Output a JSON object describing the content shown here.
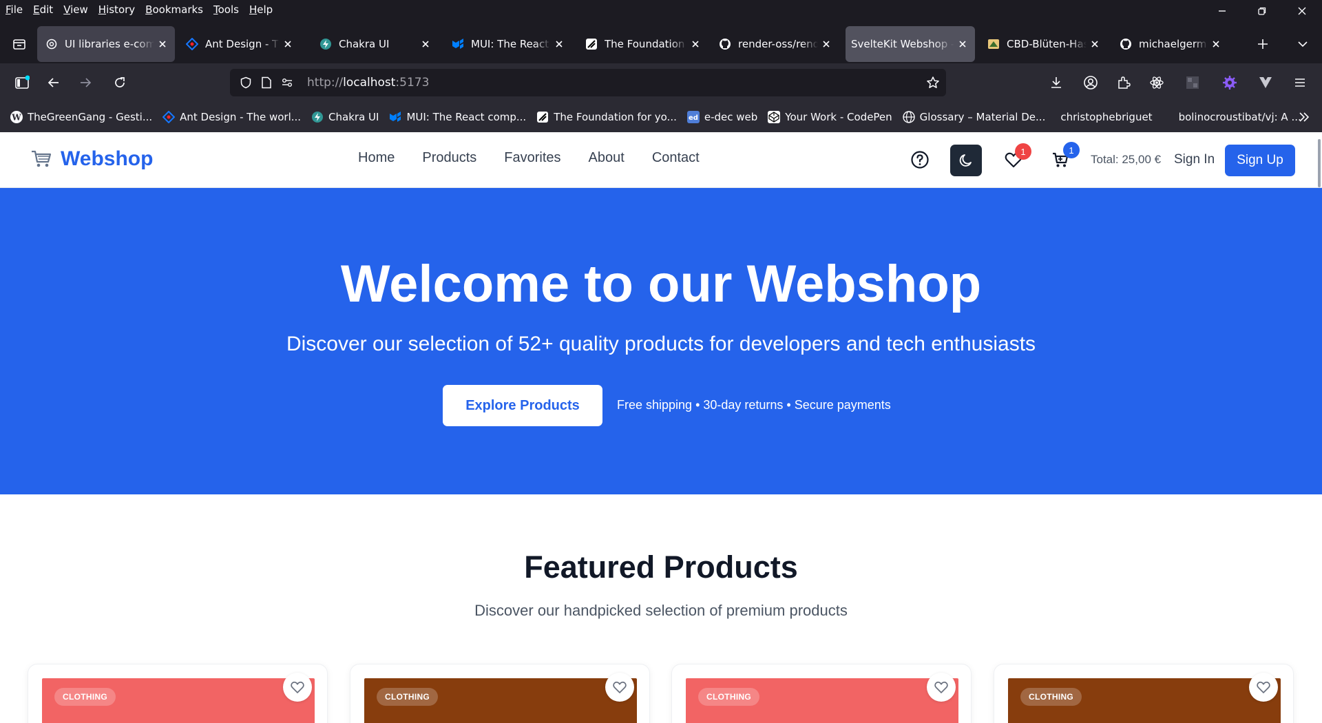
{
  "browser": {
    "menu": [
      "File",
      "Edit",
      "View",
      "History",
      "Bookmarks",
      "Tools",
      "Help"
    ],
    "tabs": [
      {
        "title": "UI libraries e-commerce",
        "icon": "openai-icon"
      },
      {
        "title": "Ant Design - The world",
        "icon": "ant-design-icon"
      },
      {
        "title": "Chakra UI",
        "icon": "chakra-icon"
      },
      {
        "title": "MUI: The React component",
        "icon": "mui-icon"
      },
      {
        "title": "The Foundation for your",
        "icon": "foundation-icon"
      },
      {
        "title": "render-oss/render",
        "icon": "github-icon"
      },
      {
        "title": "SvelteKit Webshop - Home",
        "icon": "none"
      },
      {
        "title": "CBD-Blüten-Haschisch",
        "icon": "cbd-icon"
      },
      {
        "title": "michaelgermini/Market",
        "icon": "github-icon"
      }
    ],
    "url": {
      "scheme": "http://",
      "host": "localhost",
      "port": ":5173"
    },
    "bookmarks": [
      {
        "label": "TheGreenGang - Gesti...",
        "icon": "wordpress-icon"
      },
      {
        "label": "Ant Design - The worl...",
        "icon": "ant-design-icon"
      },
      {
        "label": "Chakra UI",
        "icon": "chakra-icon"
      },
      {
        "label": "MUI: The React comp...",
        "icon": "mui-icon"
      },
      {
        "label": "The Foundation for yo...",
        "icon": "foundation-icon"
      },
      {
        "label": "e-dec web",
        "icon": "edec-icon"
      },
      {
        "label": "Your Work - CodePen",
        "icon": "codepen-icon"
      },
      {
        "label": "Glossary – Material De...",
        "icon": "globe-icon"
      },
      {
        "label": "christophebriguet",
        "icon": "none"
      },
      {
        "label": "bolinocroustibat/vj: A ...",
        "icon": "none"
      }
    ]
  },
  "site": {
    "logo": "Webshop",
    "nav": [
      "Home",
      "Products",
      "Favorites",
      "About",
      "Contact"
    ],
    "favorites_count": "1",
    "cart_count": "1",
    "total": "Total: 25,00 €",
    "signin": "Sign In",
    "signup": "Sign Up",
    "colors": {
      "brand": "#2563eb",
      "heart_badge": "#ef4444",
      "cart_badge": "#2563eb"
    }
  },
  "hero": {
    "title": "Welcome to our Webshop",
    "subtitle": "Discover our selection of 52+ quality products for developers and tech enthusiasts",
    "cta": "Explore Products",
    "perks": "Free shipping • 30-day returns • Secure payments"
  },
  "featured": {
    "title": "Featured Products",
    "subtitle": "Discover our handpicked selection of premium products",
    "products": [
      {
        "category": "CLOTHING",
        "color": "#f26464"
      },
      {
        "category": "CLOTHING",
        "color": "#873d0d"
      },
      {
        "category": "CLOTHING",
        "color": "#f26464"
      },
      {
        "category": "CLOTHING",
        "color": "#873d0d"
      }
    ]
  }
}
